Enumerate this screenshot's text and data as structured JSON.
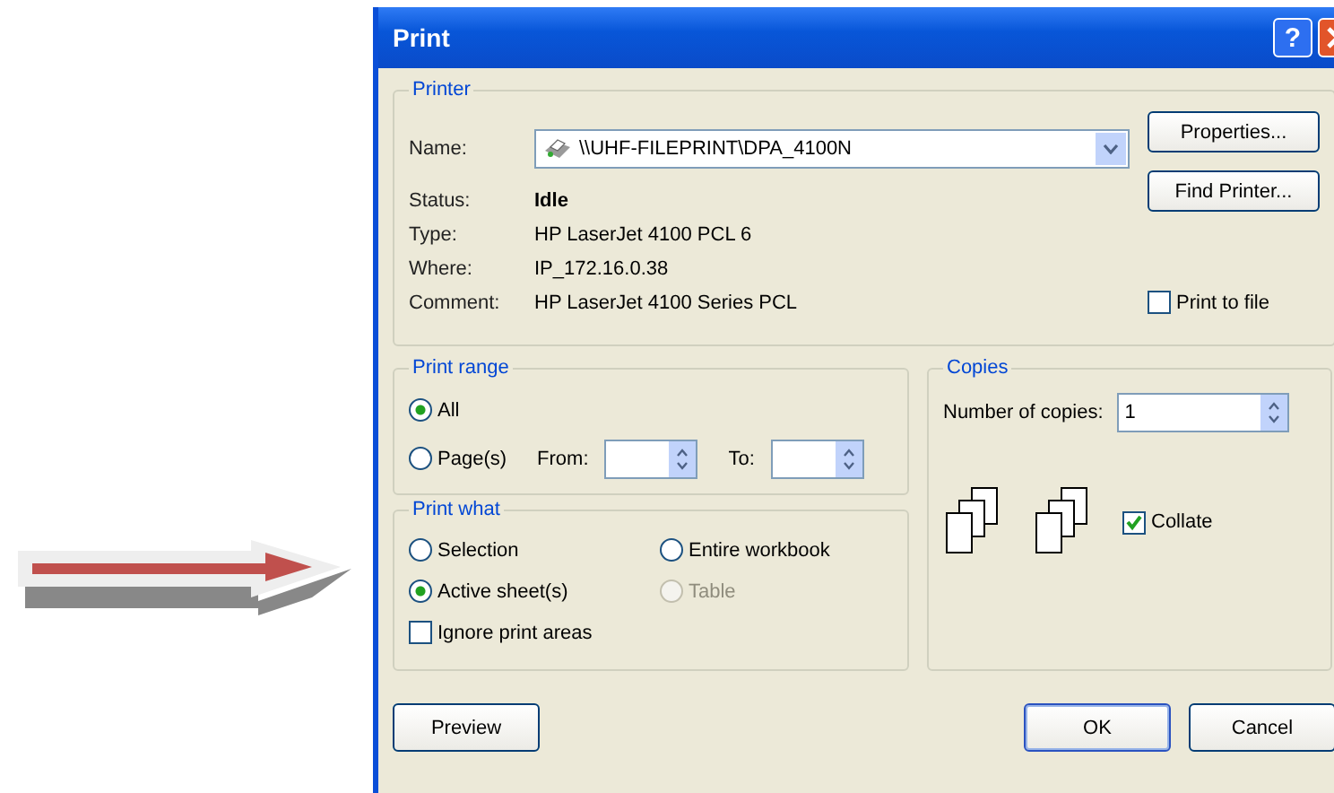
{
  "window": {
    "title": "Print",
    "help": "?"
  },
  "printer": {
    "title": "Printer",
    "name_label": "Name:",
    "name_value": "\\\\UHF-FILEPRINT\\DPA_4100N",
    "info": [
      {
        "label": "Status:",
        "value": "Idle",
        "bold": true
      },
      {
        "label": "Type:",
        "value": "HP LaserJet 4100 PCL 6",
        "bold": false
      },
      {
        "label": "Where:",
        "value": "IP_172.16.0.38",
        "bold": false
      },
      {
        "label": "Comment:",
        "value": "HP LaserJet 4100 Series PCL",
        "bold": false
      }
    ],
    "buttons": [
      "Properties...",
      "Find Printer..."
    ],
    "print_to_file": {
      "label": "Print to file",
      "checked": false
    }
  },
  "print_range": {
    "title": "Print range",
    "options": [
      {
        "label": "All",
        "selected": true
      },
      {
        "label": "Page(s)",
        "selected": false
      }
    ],
    "from_label": "From:",
    "to_label": "To:"
  },
  "print_what": {
    "title": "Print what",
    "items": [
      {
        "kind": "radio",
        "label": "Selection",
        "selected": false,
        "disabled": false
      },
      {
        "kind": "radio",
        "label": "Entire workbook",
        "selected": false,
        "disabled": false
      },
      {
        "kind": "radio",
        "label": "Active sheet(s)",
        "selected": true,
        "disabled": false
      },
      {
        "kind": "radio",
        "label": "Table",
        "selected": false,
        "disabled": true
      },
      {
        "kind": "checkbox",
        "label": "Ignore print areas",
        "selected": false,
        "disabled": false
      }
    ]
  },
  "copies": {
    "title": "Copies",
    "label": "Number of copies:",
    "value": "1",
    "collate": {
      "label": "Collate",
      "checked": true
    }
  },
  "buttons": [
    "Preview",
    "OK",
    "Cancel"
  ]
}
